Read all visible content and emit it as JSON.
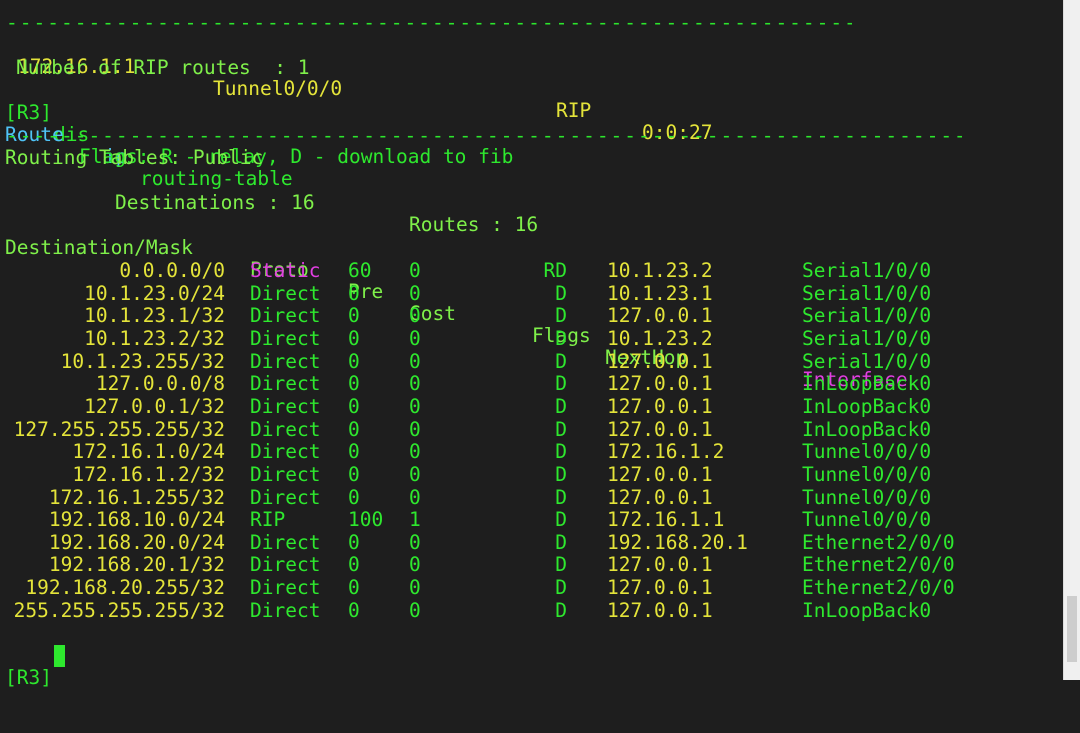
{
  "terminal": {
    "rip_route": {
      "destination": "172.16.1.1",
      "interface": "Tunnel0/0/0",
      "protocol": "RIP",
      "age": "0:0:27"
    },
    "rip_count_line": "Number of RIP routes  : 1",
    "command": {
      "prompt": "[R3]",
      "cmd": "dis",
      "arg_highlight": "ip",
      "args": "routing-table"
    },
    "flags_line": {
      "keyword": "Route",
      "rest": "Flags: R - relay, D - download to fib"
    },
    "tables_title": "Routing Tables: Public",
    "destinations_label": "Destinations : 16",
    "routes_label": "Routes : 16",
    "headers": {
      "dest": "Destination/Mask",
      "proto": "Proto",
      "pre": "Pre",
      "cost": "Cost",
      "flags": "Flags",
      "nexthop": "NextHop",
      "interface": "Interface"
    },
    "routes": [
      {
        "dest": "0.0.0.0/0",
        "proto": "Static",
        "pre": "60",
        "cost": "0",
        "flags": "RD",
        "nexthop": "10.1.23.2",
        "iface": "Serial1/0/0"
      },
      {
        "dest": "10.1.23.0/24",
        "proto": "Direct",
        "pre": "0",
        "cost": "0",
        "flags": "D",
        "nexthop": "10.1.23.1",
        "iface": "Serial1/0/0"
      },
      {
        "dest": "10.1.23.1/32",
        "proto": "Direct",
        "pre": "0",
        "cost": "0",
        "flags": "D",
        "nexthop": "127.0.0.1",
        "iface": "Serial1/0/0"
      },
      {
        "dest": "10.1.23.2/32",
        "proto": "Direct",
        "pre": "0",
        "cost": "0",
        "flags": "D",
        "nexthop": "10.1.23.2",
        "iface": "Serial1/0/0"
      },
      {
        "dest": "10.1.23.255/32",
        "proto": "Direct",
        "pre": "0",
        "cost": "0",
        "flags": "D",
        "nexthop": "127.0.0.1",
        "iface": "Serial1/0/0"
      },
      {
        "dest": "127.0.0.0/8",
        "proto": "Direct",
        "pre": "0",
        "cost": "0",
        "flags": "D",
        "nexthop": "127.0.0.1",
        "iface": "InLoopBack0"
      },
      {
        "dest": "127.0.0.1/32",
        "proto": "Direct",
        "pre": "0",
        "cost": "0",
        "flags": "D",
        "nexthop": "127.0.0.1",
        "iface": "InLoopBack0"
      },
      {
        "dest": "127.255.255.255/32",
        "proto": "Direct",
        "pre": "0",
        "cost": "0",
        "flags": "D",
        "nexthop": "127.0.0.1",
        "iface": "InLoopBack0"
      },
      {
        "dest": "172.16.1.0/24",
        "proto": "Direct",
        "pre": "0",
        "cost": "0",
        "flags": "D",
        "nexthop": "172.16.1.2",
        "iface": "Tunnel0/0/0"
      },
      {
        "dest": "172.16.1.2/32",
        "proto": "Direct",
        "pre": "0",
        "cost": "0",
        "flags": "D",
        "nexthop": "127.0.0.1",
        "iface": "Tunnel0/0/0"
      },
      {
        "dest": "172.16.1.255/32",
        "proto": "Direct",
        "pre": "0",
        "cost": "0",
        "flags": "D",
        "nexthop": "127.0.0.1",
        "iface": "Tunnel0/0/0"
      },
      {
        "dest": "192.168.10.0/24",
        "proto": "RIP",
        "pre": "100",
        "cost": "1",
        "flags": "D",
        "nexthop": "172.16.1.1",
        "iface": "Tunnel0/0/0"
      },
      {
        "dest": "192.168.20.0/24",
        "proto": "Direct",
        "pre": "0",
        "cost": "0",
        "flags": "D",
        "nexthop": "192.168.20.1",
        "iface": "Ethernet2/0/0"
      },
      {
        "dest": "192.168.20.1/32",
        "proto": "Direct",
        "pre": "0",
        "cost": "0",
        "flags": "D",
        "nexthop": "127.0.0.1",
        "iface": "Ethernet2/0/0"
      },
      {
        "dest": "192.168.20.255/32",
        "proto": "Direct",
        "pre": "0",
        "cost": "0",
        "flags": "D",
        "nexthop": "127.0.0.1",
        "iface": "Ethernet2/0/0"
      },
      {
        "dest": "255.255.255.255/32",
        "proto": "Direct",
        "pre": "0",
        "cost": "0",
        "flags": "D",
        "nexthop": "127.0.0.1",
        "iface": "InLoopBack0"
      }
    ],
    "final_prompt": "[R3]",
    "colors": {
      "background": "#1e1e1e",
      "green": "#2ee82e",
      "yellow": "#e4e43a",
      "cyan": "#4fc3f7",
      "magenta": "#e13ee1"
    }
  }
}
